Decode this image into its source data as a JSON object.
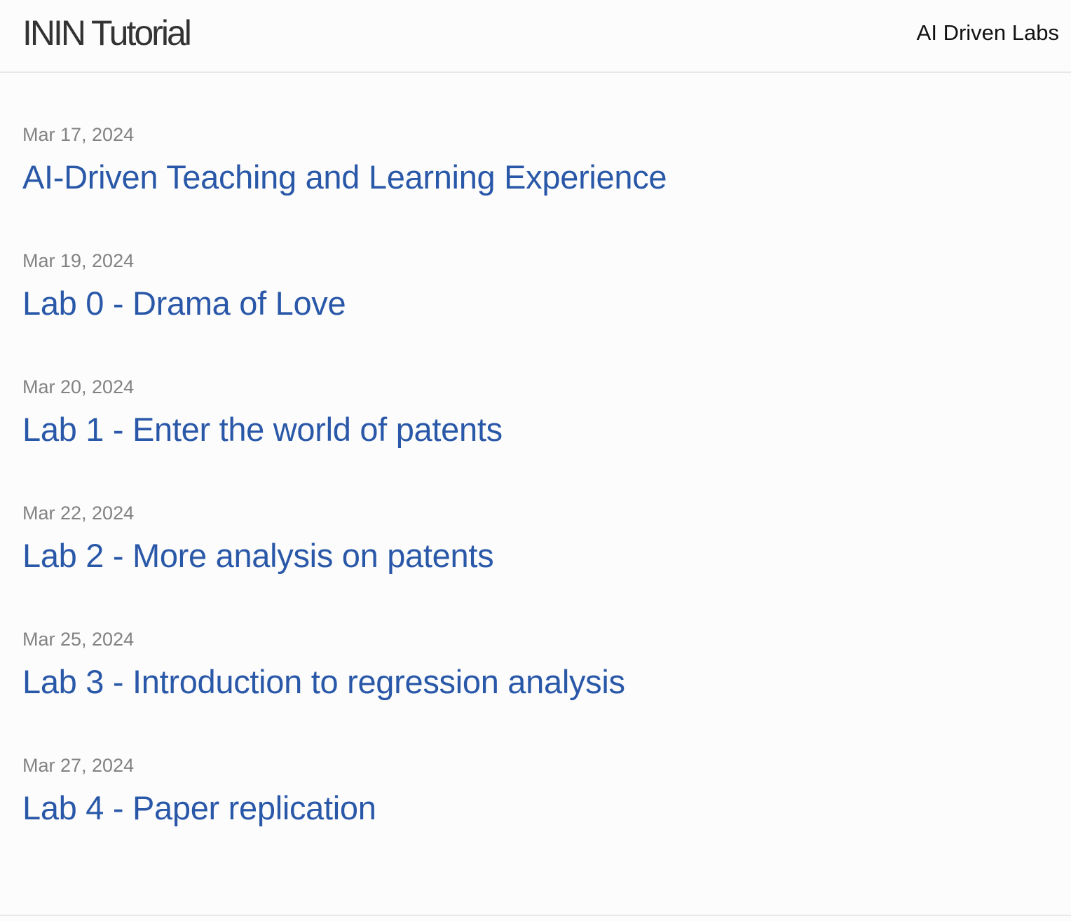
{
  "header": {
    "site_title": "ININ Tutorial",
    "nav": [
      "AI Driven Labs"
    ]
  },
  "posts": [
    {
      "date": "Mar 17, 2024",
      "title": "AI-Driven Teaching and Learning Experience"
    },
    {
      "date": "Mar 19, 2024",
      "title": "Lab 0 - Drama of Love"
    },
    {
      "date": "Mar 20, 2024",
      "title": "Lab 1 - Enter the world of patents"
    },
    {
      "date": "Mar 22, 2024",
      "title": "Lab 2 - More analysis on patents"
    },
    {
      "date": "Mar 25, 2024",
      "title": "Lab 3 - Introduction to regression analysis"
    },
    {
      "date": "Mar 27, 2024",
      "title": "Lab 4 - Paper replication"
    }
  ],
  "colors": {
    "link": "#2a58a8",
    "meta": "#828282",
    "title": "#333333",
    "background": "#fcfcfc"
  }
}
